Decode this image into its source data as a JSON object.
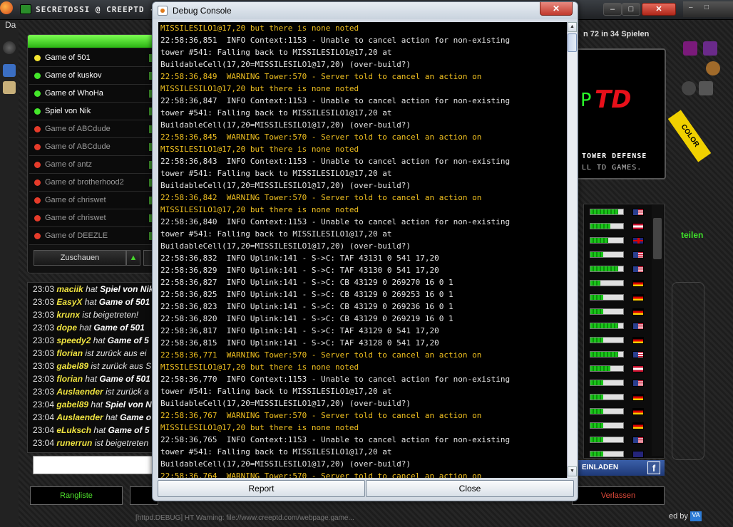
{
  "game_window": {
    "title": "SECRETOSSI @ CREEPTD - C",
    "menu_label": "Da",
    "controls": {
      "minimize": "–",
      "maximize": "□",
      "close": "✕"
    }
  },
  "games_panel": {
    "games": [
      {
        "name": "Game of 501",
        "status": "yellow"
      },
      {
        "name": "Game of kuskov",
        "status": "green"
      },
      {
        "name": "Game of WhoHa",
        "status": "green"
      },
      {
        "name": "Spiel von Nik",
        "status": "green"
      },
      {
        "name": "Game of ABCdude",
        "status": "red"
      },
      {
        "name": "Game of ABCdude",
        "status": "red"
      },
      {
        "name": "Game of antz",
        "status": "red"
      },
      {
        "name": "Game of brotherhood2",
        "status": "red"
      },
      {
        "name": "Game of chriswet",
        "status": "red"
      },
      {
        "name": "Game of chriswet",
        "status": "red"
      },
      {
        "name": "Game of DEEZLE",
        "status": "red"
      }
    ],
    "watch_button": "Zuschauen",
    "up_arrow": "▲"
  },
  "chat": {
    "lines": [
      {
        "time": "23:03",
        "user": "maciik",
        "action": "hat",
        "detail": "Spiel von Nik"
      },
      {
        "time": "23:03",
        "user": "EasyX",
        "action": "hat",
        "detail": "Game of 501"
      },
      {
        "time": "23:03",
        "user": "krunx",
        "action": "ist beigetreten!",
        "detail": ""
      },
      {
        "time": "23:03",
        "user": "dope",
        "action": "hat",
        "detail": "Game of 501"
      },
      {
        "time": "23:03",
        "user": "speedy2",
        "action": "hat",
        "detail": "Game of 5"
      },
      {
        "time": "23:03",
        "user": "florian",
        "action": "ist zurück aus ei",
        "detail": ""
      },
      {
        "time": "23:03",
        "user": "gabel89",
        "action": "ist zurück aus S",
        "detail": ""
      },
      {
        "time": "23:03",
        "user": "florian",
        "action": "hat",
        "detail": "Game of 501"
      },
      {
        "time": "23:03",
        "user": "Auslaender",
        "action": "ist zurück a",
        "detail": ""
      },
      {
        "time": "23:04",
        "user": "gabel89",
        "action": "hat",
        "detail": "Spiel von N"
      },
      {
        "time": "23:04",
        "user": "Auslaender",
        "action": "hat",
        "detail": "Game o"
      },
      {
        "time": "23:04",
        "user": "eLuksch",
        "action": "hat",
        "detail": "Game of 5"
      },
      {
        "time": "23:04",
        "user": "runerrun",
        "action": "ist beigetreten",
        "detail": ""
      }
    ]
  },
  "bottom_bar": {
    "rangliste": "Rangliste",
    "verlassen": "Verlassen",
    "status_text": "[httpd.DEBUG] HT Warning: file://www.creeptd.com/webpage.game...",
    "made_by": "ed by"
  },
  "right_panel": {
    "online_info": "n 72 in 34 Spielen",
    "logo_td": "TD",
    "logo_p": "P",
    "tagline1": "TOWER DEFENSE",
    "tagline2": "LL TD GAMES.",
    "sash": "COLOR",
    "link_text": "teilen",
    "einladen": "EINLADEN",
    "fb": "f",
    "players": [
      {
        "level": 0.85,
        "flag": "us"
      },
      {
        "level": 0.6,
        "flag": "at"
      },
      {
        "level": 0.55,
        "flag": "uk"
      },
      {
        "level": 0.4,
        "flag": "us"
      },
      {
        "level": 0.85,
        "flag": "us"
      },
      {
        "level": 0.3,
        "flag": "de"
      },
      {
        "level": 0.4,
        "flag": "de"
      },
      {
        "level": 0.4,
        "flag": "de"
      },
      {
        "level": 0.85,
        "flag": "us"
      },
      {
        "level": 0.4,
        "flag": "de"
      },
      {
        "level": 0.85,
        "flag": "us"
      },
      {
        "level": 0.6,
        "flag": "at"
      },
      {
        "level": 0.4,
        "flag": "us"
      },
      {
        "level": 0.4,
        "flag": "de"
      },
      {
        "level": 0.4,
        "flag": "de"
      },
      {
        "level": 0.4,
        "flag": "de"
      },
      {
        "level": 0.4,
        "flag": "us"
      },
      {
        "level": 0.4,
        "flag": "au"
      },
      {
        "level": 0.85,
        "flag": "us"
      }
    ]
  },
  "debug_console": {
    "title": "Debug Console",
    "close_glyph": "✕",
    "report_button": "Report",
    "close_button": "Close",
    "log_lines": [
      {
        "type": "warning",
        "text": "MISSILESILO1@17,20 but there is none noted"
      },
      {
        "type": "info",
        "text": "22:58:36,851  INFO Context:1153 - Unable to cancel action for non-existing"
      },
      {
        "type": "info",
        "text": "tower #541: Falling back to MISSILESILO1@17,20 at"
      },
      {
        "type": "info",
        "text": "BuildableCell(17,20=MISSILESILO1@17,20) (over-build?)"
      },
      {
        "type": "warning",
        "text": "22:58:36,849  WARNING Tower:570 - Server told to cancel an action on"
      },
      {
        "type": "warning",
        "text": "MISSILESILO1@17,20 but there is none noted"
      },
      {
        "type": "info",
        "text": "22:58:36,847  INFO Context:1153 - Unable to cancel action for non-existing"
      },
      {
        "type": "info",
        "text": "tower #541: Falling back to MISSILESILO1@17,20 at"
      },
      {
        "type": "info",
        "text": "BuildableCell(17,20=MISSILESILO1@17,20) (over-build?)"
      },
      {
        "type": "warning",
        "text": "22:58:36,845  WARNING Tower:570 - Server told to cancel an action on"
      },
      {
        "type": "warning",
        "text": "MISSILESILO1@17,20 but there is none noted"
      },
      {
        "type": "info",
        "text": "22:58:36,843  INFO Context:1153 - Unable to cancel action for non-existing"
      },
      {
        "type": "info",
        "text": "tower #541: Falling back to MISSILESILO1@17,20 at"
      },
      {
        "type": "info",
        "text": "BuildableCell(17,20=MISSILESILO1@17,20) (over-build?)"
      },
      {
        "type": "warning",
        "text": "22:58:36,842  WARNING Tower:570 - Server told to cancel an action on"
      },
      {
        "type": "warning",
        "text": "MISSILESILO1@17,20 but there is none noted"
      },
      {
        "type": "info",
        "text": "22:58:36,840  INFO Context:1153 - Unable to cancel action for non-existing"
      },
      {
        "type": "info",
        "text": "tower #541: Falling back to MISSILESILO1@17,20 at"
      },
      {
        "type": "info",
        "text": "BuildableCell(17,20=MISSILESILO1@17,20) (over-build?)"
      },
      {
        "type": "info",
        "text": "22:58:36,832  INFO Uplink:141 - S->C: TAF 43131 0 541 17,20"
      },
      {
        "type": "info",
        "text": "22:58:36,829  INFO Uplink:141 - S->C: TAF 43130 0 541 17,20"
      },
      {
        "type": "info",
        "text": "22:58:36,827  INFO Uplink:141 - S->C: CB 43129 0 269270 16 0 1"
      },
      {
        "type": "info",
        "text": "22:58:36,825  INFO Uplink:141 - S->C: CB 43129 0 269253 16 0 1"
      },
      {
        "type": "info",
        "text": "22:58:36,823  INFO Uplink:141 - S->C: CB 43129 0 269236 16 0 1"
      },
      {
        "type": "info",
        "text": "22:58:36,820  INFO Uplink:141 - S->C: CB 43129 0 269219 16 0 1"
      },
      {
        "type": "info",
        "text": "22:58:36,817  INFO Uplink:141 - S->C: TAF 43129 0 541 17,20"
      },
      {
        "type": "info",
        "text": "22:58:36,815  INFO Uplink:141 - S->C: TAF 43128 0 541 17,20"
      },
      {
        "type": "warning",
        "text": "22:58:36,771  WARNING Tower:570 - Server told to cancel an action on"
      },
      {
        "type": "warning",
        "text": "MISSILESILO1@17,20 but there is none noted"
      },
      {
        "type": "info",
        "text": "22:58:36,770  INFO Context:1153 - Unable to cancel action for non-existing"
      },
      {
        "type": "info",
        "text": "tower #541: Falling back to MISSILESILO1@17,20 at"
      },
      {
        "type": "info",
        "text": "BuildableCell(17,20=MISSILESILO1@17,20) (over-build?)"
      },
      {
        "type": "warning",
        "text": "22:58:36,767  WARNING Tower:570 - Server told to cancel an action on"
      },
      {
        "type": "warning",
        "text": "MISSILESILO1@17,20 but there is none noted"
      },
      {
        "type": "info",
        "text": "22:58:36,765  INFO Context:1153 - Unable to cancel action for non-existing"
      },
      {
        "type": "info",
        "text": "tower #541: Falling back to MISSILESILO1@17,20 at"
      },
      {
        "type": "info",
        "text": "BuildableCell(17,20=MISSILESILO1@17,20) (over-build?)"
      },
      {
        "type": "warning",
        "text": "22:58:36,764  WARNING Tower:570 - Server told to cancel an action on"
      }
    ]
  }
}
